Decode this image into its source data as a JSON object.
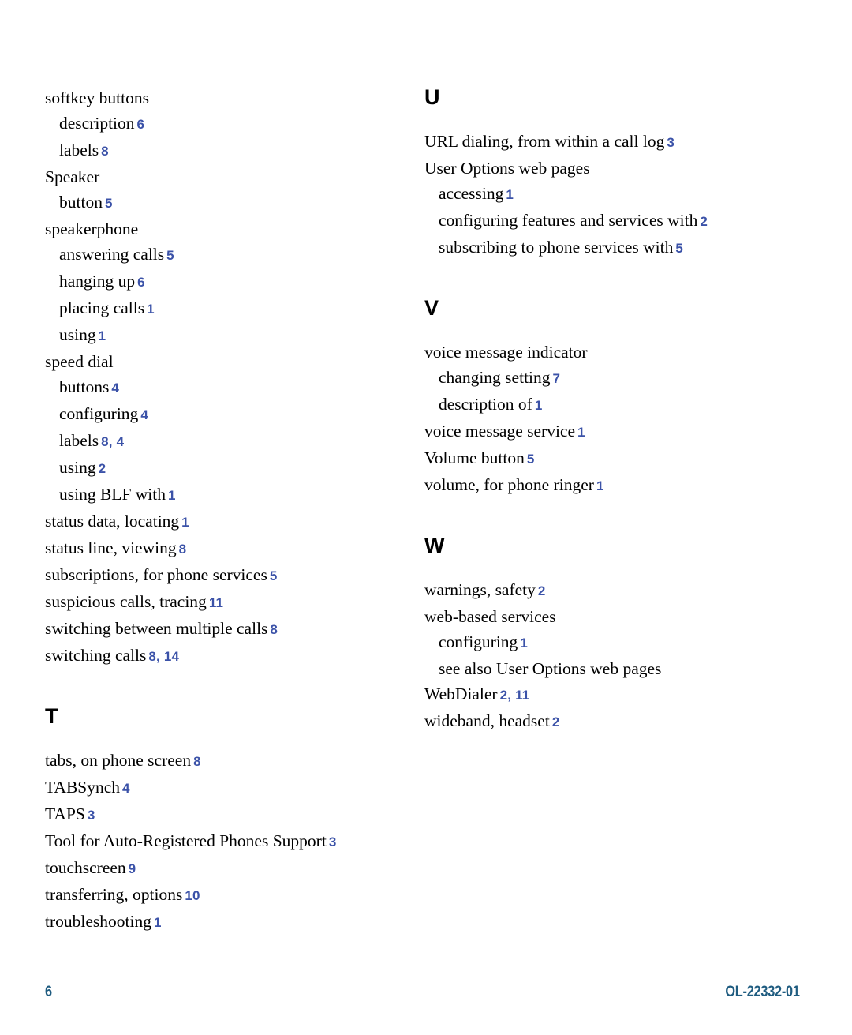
{
  "document": {
    "type": "index",
    "page_number": "6",
    "document_number": "OL-22332-01",
    "colors": {
      "page_reference": "#3b52a8",
      "footer": "#1f5c80",
      "heading": "#000000",
      "body_text": "#000000"
    }
  },
  "columns": {
    "left": [
      {
        "heading": null,
        "entries": [
          {
            "level": 1,
            "label": "softkey buttons",
            "pages": ""
          },
          {
            "level": 2,
            "label": "description",
            "pages": "6"
          },
          {
            "level": 2,
            "label": "labels",
            "pages": "8"
          },
          {
            "level": 1,
            "label": "Speaker",
            "pages": ""
          },
          {
            "level": 2,
            "label": "button",
            "pages": "5"
          },
          {
            "level": 1,
            "label": "speakerphone",
            "pages": ""
          },
          {
            "level": 2,
            "label": "answering calls",
            "pages": "5"
          },
          {
            "level": 2,
            "label": "hanging up",
            "pages": "6"
          },
          {
            "level": 2,
            "label": "placing calls",
            "pages": "1"
          },
          {
            "level": 2,
            "label": "using",
            "pages": "1"
          },
          {
            "level": 1,
            "label": "speed dial",
            "pages": ""
          },
          {
            "level": 2,
            "label": "buttons",
            "pages": "4"
          },
          {
            "level": 2,
            "label": "configuring",
            "pages": "4"
          },
          {
            "level": 2,
            "label": "labels",
            "pages": "8, 4"
          },
          {
            "level": 2,
            "label": "using",
            "pages": "2"
          },
          {
            "level": 2,
            "label": "using BLF with",
            "pages": "1"
          },
          {
            "level": 1,
            "label": "status data, locating",
            "pages": "1"
          },
          {
            "level": 1,
            "label": "status line, viewing",
            "pages": "8"
          },
          {
            "level": 1,
            "label": "subscriptions, for phone services",
            "pages": "5"
          },
          {
            "level": 1,
            "label": "suspicious calls, tracing",
            "pages": "11"
          },
          {
            "level": 1,
            "label": "switching between multiple calls",
            "pages": "8"
          },
          {
            "level": 1,
            "label": "switching calls",
            "pages": "8, 14"
          }
        ]
      },
      {
        "heading": "T",
        "entries": [
          {
            "level": 1,
            "label": "tabs, on phone screen",
            "pages": "8"
          },
          {
            "level": 1,
            "label": "TABSynch",
            "pages": "4"
          },
          {
            "level": 1,
            "label": "TAPS",
            "pages": "3"
          },
          {
            "level": 1,
            "label": "Tool for Auto-Registered Phones Support",
            "pages": "3"
          },
          {
            "level": 1,
            "label": "touchscreen",
            "pages": "9"
          },
          {
            "level": 1,
            "label": "transferring, options",
            "pages": "10"
          },
          {
            "level": 1,
            "label": "troubleshooting",
            "pages": "1"
          }
        ]
      }
    ],
    "right": [
      {
        "heading": "U",
        "entries": [
          {
            "level": 1,
            "label": "URL dialing, from within a call log",
            "pages": "3"
          },
          {
            "level": 1,
            "label": "User Options web pages",
            "pages": ""
          },
          {
            "level": 2,
            "label": "accessing",
            "pages": "1"
          },
          {
            "level": 2,
            "label": "configuring features and services with",
            "pages": "2"
          },
          {
            "level": 2,
            "label": "subscribing to phone services with",
            "pages": "5"
          }
        ]
      },
      {
        "heading": "V",
        "entries": [
          {
            "level": 1,
            "label": "voice message indicator",
            "pages": ""
          },
          {
            "level": 2,
            "label": "changing setting",
            "pages": "7"
          },
          {
            "level": 2,
            "label": "description of",
            "pages": "1"
          },
          {
            "level": 1,
            "label": "voice message service",
            "pages": "1"
          },
          {
            "level": 1,
            "label": "Volume button",
            "pages": "5"
          },
          {
            "level": 1,
            "label": "volume, for phone ringer",
            "pages": "1"
          }
        ]
      },
      {
        "heading": "W",
        "entries": [
          {
            "level": 1,
            "label": "warnings, safety",
            "pages": "2"
          },
          {
            "level": 1,
            "label": "web-based services",
            "pages": ""
          },
          {
            "level": 2,
            "label": "configuring",
            "pages": "1"
          },
          {
            "level": 2,
            "label": "see also User Options web pages",
            "pages": ""
          },
          {
            "level": 1,
            "label": "WebDialer",
            "pages": "2, 11"
          },
          {
            "level": 1,
            "label": "wideband, headset",
            "pages": "2"
          }
        ]
      }
    ]
  }
}
